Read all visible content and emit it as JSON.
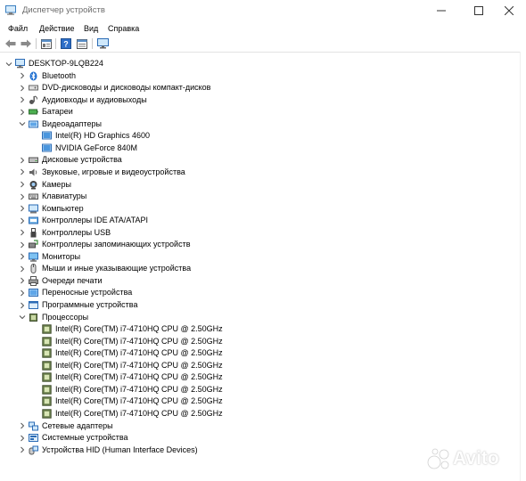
{
  "window": {
    "title": "Диспетчер устройств",
    "controls": [
      "minimize-icon",
      "maximize-icon",
      "close-icon"
    ]
  },
  "menu": [
    "Файл",
    "Действие",
    "Вид",
    "Справка"
  ],
  "toolbar": [
    "back-icon",
    "forward-icon",
    "properties-icon",
    "help-icon",
    "details-icon",
    "monitor-icon"
  ],
  "tree": {
    "root": "DESKTOP-9LQB224",
    "categories": [
      {
        "label": "Bluetooth",
        "icon": "bluetooth-icon",
        "expanded": false
      },
      {
        "label": "DVD-дисководы и дисководы компакт-дисков",
        "icon": "dvd-icon",
        "expanded": false
      },
      {
        "label": "Аудиовходы и аудиовыходы",
        "icon": "audio-icon",
        "expanded": false
      },
      {
        "label": "Батареи",
        "icon": "battery-icon",
        "expanded": false
      },
      {
        "label": "Видеоадаптеры",
        "icon": "display-adapter-icon",
        "expanded": true,
        "children": [
          "Intel(R) HD Graphics 4600",
          "NVIDIA GeForce 840M"
        ]
      },
      {
        "label": "Дисковые устройства",
        "icon": "disk-icon",
        "expanded": false
      },
      {
        "label": "Звуковые, игровые и видеоустройства",
        "icon": "sound-icon",
        "expanded": false
      },
      {
        "label": "Камеры",
        "icon": "camera-icon",
        "expanded": false
      },
      {
        "label": "Клавиатуры",
        "icon": "keyboard-icon",
        "expanded": false
      },
      {
        "label": "Компьютер",
        "icon": "computer-icon",
        "expanded": false
      },
      {
        "label": "Контроллеры IDE ATA/ATAPI",
        "icon": "ide-icon",
        "expanded": false
      },
      {
        "label": "Контроллеры USB",
        "icon": "usb-icon",
        "expanded": false
      },
      {
        "label": "Контроллеры запоминающих устройств",
        "icon": "storage-controller-icon",
        "expanded": false
      },
      {
        "label": "Мониторы",
        "icon": "monitor-icon",
        "expanded": false
      },
      {
        "label": "Мыши и иные указывающие устройства",
        "icon": "mouse-icon",
        "expanded": false
      },
      {
        "label": "Очереди печати",
        "icon": "printer-icon",
        "expanded": false
      },
      {
        "label": "Переносные устройства",
        "icon": "portable-icon",
        "expanded": false
      },
      {
        "label": "Программные устройства",
        "icon": "software-device-icon",
        "expanded": false
      },
      {
        "label": "Процессоры",
        "icon": "processor-icon",
        "expanded": true,
        "children": [
          "Intel(R) Core(TM) i7-4710HQ CPU @ 2.50GHz",
          "Intel(R) Core(TM) i7-4710HQ CPU @ 2.50GHz",
          "Intel(R) Core(TM) i7-4710HQ CPU @ 2.50GHz",
          "Intel(R) Core(TM) i7-4710HQ CPU @ 2.50GHz",
          "Intel(R) Core(TM) i7-4710HQ CPU @ 2.50GHz",
          "Intel(R) Core(TM) i7-4710HQ CPU @ 2.50GHz",
          "Intel(R) Core(TM) i7-4710HQ CPU @ 2.50GHz",
          "Intel(R) Core(TM) i7-4710HQ CPU @ 2.50GHz"
        ]
      },
      {
        "label": "Сетевые адаптеры",
        "icon": "network-icon",
        "expanded": false
      },
      {
        "label": "Системные устройства",
        "icon": "system-device-icon",
        "expanded": false
      },
      {
        "label": "Устройства HID (Human Interface Devices)",
        "icon": "hid-icon",
        "expanded": false
      }
    ]
  },
  "watermark": "Avito"
}
